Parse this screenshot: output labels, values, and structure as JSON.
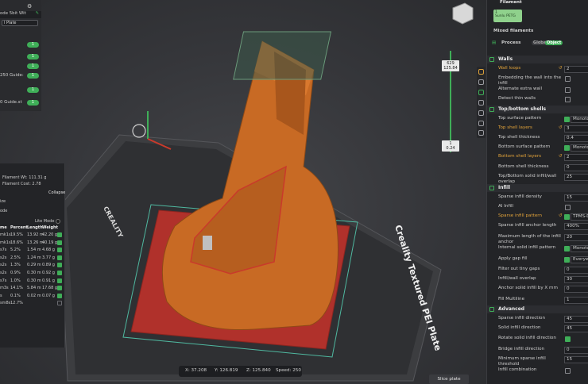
{
  "left_panel": {
    "rows": [
      {
        "label": "ode 5bit Wit",
        "badge": ""
      },
      {
        "label": "l Plate",
        "badge": ""
      },
      {
        "label": "",
        "badge": "1"
      },
      {
        "label": "",
        "badge": "1"
      },
      {
        "label": "",
        "badge": "1"
      },
      {
        "label": "250 Guide:",
        "badge": "1"
      },
      {
        "label": "",
        "badge": "1"
      },
      {
        "label": "0 Guide.st",
        "badge": "1"
      }
    ]
  },
  "filament_panel": {
    "weight": "Filament Wt: 111.31 g",
    "cost": "Filament Cost: 2.78",
    "collapse_label": "Collapse",
    "size_label": "ize",
    "mode_label": "ode",
    "lite_mode_label": "Lite Mode",
    "headers": [
      "me",
      "Percent",
      "Length",
      "Weight"
    ],
    "rows": [
      {
        "name": "mk1s",
        "pct": "19.5%",
        "len": "13.92 m",
        "wt": "42.20 g",
        "checked": true
      },
      {
        "name": "mk1s",
        "pct": "18.6%",
        "len": "13.26 m",
        "wt": "40.19 g",
        "checked": true
      },
      {
        "name": "s7s",
        "pct": "5.2%",
        "len": "1.54 m",
        "wt": "4.68 g",
        "checked": true
      },
      {
        "name": "s2s",
        "pct": "2.5%",
        "len": "1.24 m",
        "wt": "3.77 g",
        "checked": true
      },
      {
        "name": "s2s",
        "pct": "1.3%",
        "len": "0.29 m",
        "wt": "0.89 g",
        "checked": true
      },
      {
        "name": "s2s",
        "pct": "0.9%",
        "len": "0.30 m",
        "wt": "0.92 g",
        "checked": true
      },
      {
        "name": "s7s",
        "pct": "1.0%",
        "len": "0.30 m",
        "wt": "0.91 g",
        "checked": true
      },
      {
        "name": "m3s",
        "pct": "14.1%",
        "len": "5.84 m",
        "wt": "17.68 g",
        "checked": true
      },
      {
        "name": "s",
        "pct": "0.1%",
        "len": "0.02 m",
        "wt": "0.07 g",
        "checked": true
      },
      {
        "name": "sm8s",
        "pct": "12.7%",
        "len": "",
        "wt": "",
        "checked": false
      }
    ]
  },
  "viewport": {
    "plate_label": "Creality Textured PEI Plate",
    "brand_label": "CREALITY",
    "slider_top_line1": "629",
    "slider_top_line2": "125.84",
    "slider_bottom_line1": "1",
    "slider_bottom_line2": "0.24",
    "coords": {
      "x": "X: 37.208",
      "y": "Y: 126.819",
      "z": "Z: 125.840",
      "speed": "Speed: 250"
    },
    "slice_button": "Slice plate"
  },
  "right_panel": {
    "filament_title": "Filament",
    "filament_chip_num": "1",
    "filament_chip_name": "Sunlu PETG",
    "mixed_filaments": "Mixed filaments",
    "process_title": "Process",
    "toggle_off": "Global",
    "toggle_on": "Object",
    "sections": {
      "walls": "Walls",
      "topbottom": "Top/bottom shells",
      "infill": "Infill",
      "advanced": "Advanced"
    },
    "walls_rows": [
      {
        "label": "Wall loops",
        "value": "2",
        "kind": "num",
        "orange": true
      },
      {
        "label": "Embedding the wall into the infill",
        "value": "",
        "kind": "cb",
        "checked": false
      },
      {
        "label": "Alternate extra wall",
        "value": "",
        "kind": "cb",
        "checked": false
      },
      {
        "label": "Detect thin walls",
        "value": "",
        "kind": "cb",
        "checked": false
      }
    ],
    "topbottom_rows": [
      {
        "label": "Top surface pattern",
        "value": "Monotonic",
        "kind": "sel",
        "orange": false
      },
      {
        "label": "Top shell layers",
        "value": "3",
        "kind": "num",
        "orange": true
      },
      {
        "label": "Top shell thickness",
        "value": "0.4",
        "kind": "num",
        "orange": false
      },
      {
        "label": "Bottom surface pattern",
        "value": "Monotonic",
        "kind": "sel",
        "orange": false
      },
      {
        "label": "Bottom shell layers",
        "value": "2",
        "kind": "num",
        "orange": true
      },
      {
        "label": "Bottom shell thickness",
        "value": "0",
        "kind": "num",
        "orange": false
      },
      {
        "label": "Top/Bottom solid infill/wall overlap",
        "value": "25",
        "kind": "num",
        "orange": false
      }
    ],
    "infill_rows": [
      {
        "label": "Sparse infill density",
        "value": "15",
        "kind": "num",
        "orange": false
      },
      {
        "label": "AI Infill",
        "value": "",
        "kind": "cb",
        "checked": false
      },
      {
        "label": "Sparse infill pattern",
        "value": "TPMS-D",
        "kind": "sel",
        "orange": true
      },
      {
        "label": "Sparse infill anchor length",
        "value": "400%",
        "kind": "num",
        "orange": false
      },
      {
        "label": "Maximum length of the infill anchor",
        "value": "20",
        "kind": "num",
        "orange": false
      },
      {
        "label": "Internal solid infill pattern",
        "value": "Monotonic",
        "kind": "sel",
        "orange": false
      },
      {
        "label": "Apply gap fill",
        "value": "Everywhere",
        "kind": "sel",
        "orange": false
      },
      {
        "label": "Filter out tiny gaps",
        "value": "0",
        "kind": "num",
        "orange": false
      },
      {
        "label": "Infill/wall overlap",
        "value": "30",
        "kind": "num",
        "orange": false
      },
      {
        "label": "Anchor solid infill by X mm",
        "value": "0",
        "kind": "num",
        "orange": false
      },
      {
        "label": "Fill Multiline",
        "value": "1",
        "kind": "num",
        "orange": false
      }
    ],
    "advanced_rows": [
      {
        "label": "Sparse infill direction",
        "value": "45",
        "kind": "num",
        "orange": false
      },
      {
        "label": "Solid infill direction",
        "value": "45",
        "kind": "num",
        "orange": false
      },
      {
        "label": "Rotate solid infill direction",
        "value": "",
        "kind": "cb",
        "checked": true
      },
      {
        "label": "Bridge infill direction",
        "value": "0",
        "kind": "num",
        "orange": false
      },
      {
        "label": "Minimum sparse infill threshold",
        "value": "15",
        "kind": "num",
        "orange": false
      },
      {
        "label": "Infill combination",
        "value": "",
        "kind": "cb",
        "checked": false
      }
    ]
  },
  "colors": {
    "accent": "#3fae58",
    "model": "#c86a24",
    "plate": "#b0312b",
    "orange_label": "#e2a33a"
  }
}
